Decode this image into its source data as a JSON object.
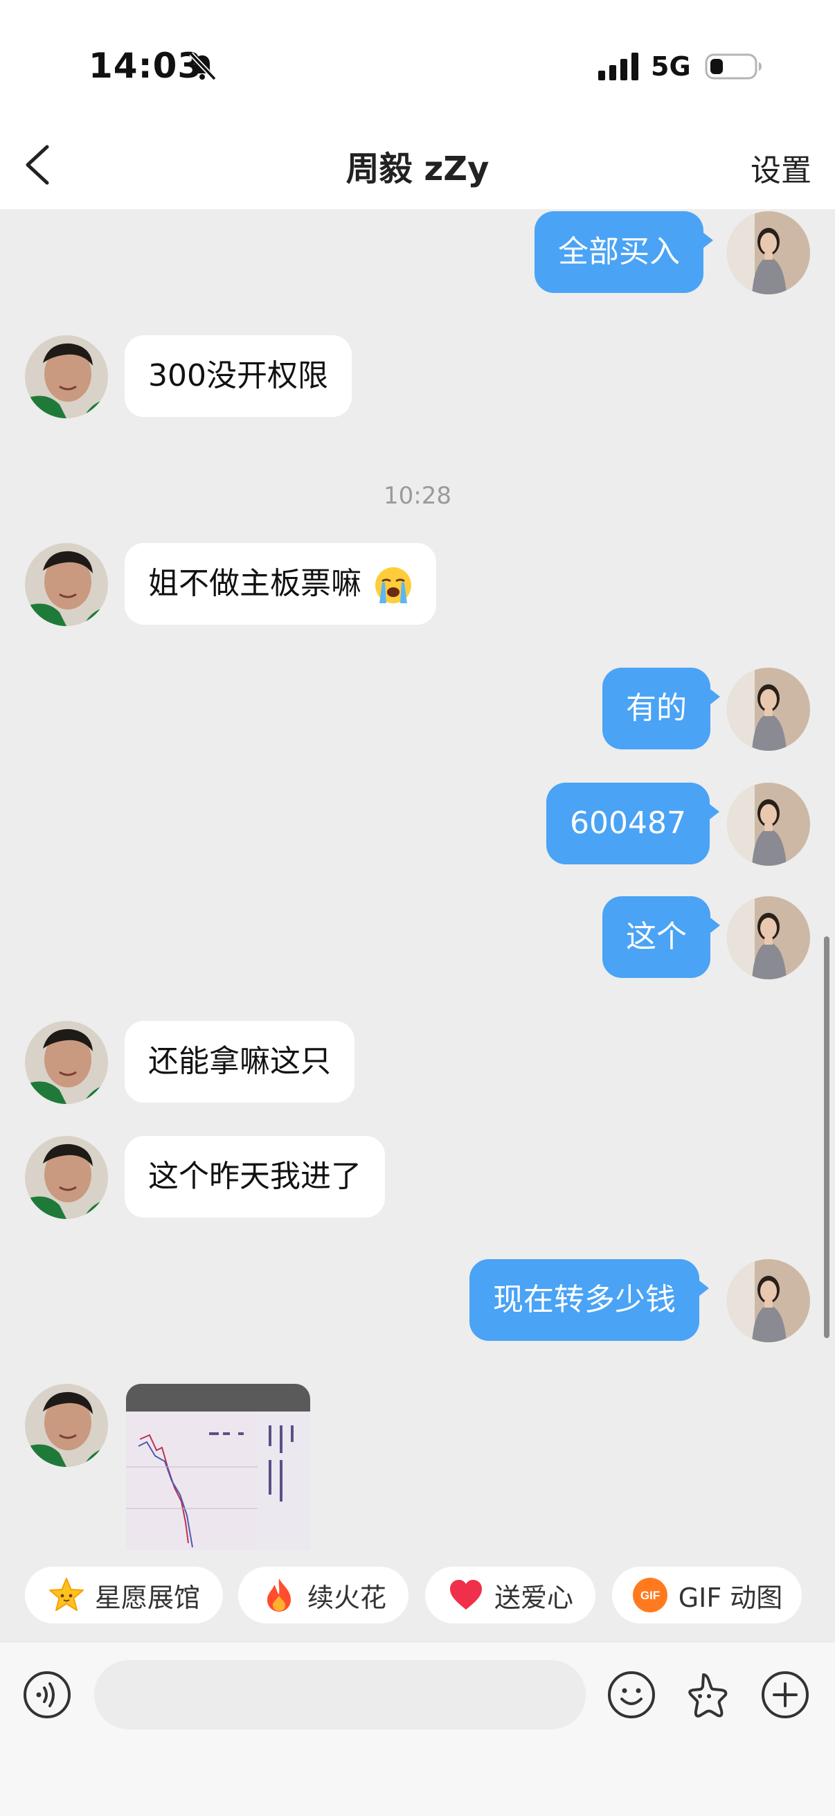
{
  "status_bar": {
    "time": "14:03",
    "network": "5G",
    "icons": [
      "bell-slash-icon",
      "signal-icon",
      "battery-icon"
    ]
  },
  "nav": {
    "title": "周毅 zZy",
    "settings": "设置",
    "back_icon": "chevron-left-icon"
  },
  "messages": [
    {
      "from": "me",
      "text": "全部买入"
    },
    {
      "from": "them",
      "text": "300没开权限"
    },
    {
      "type": "timestamp",
      "text": "10:28"
    },
    {
      "from": "them",
      "text": "姐不做主板票嘛",
      "emoji": "loudly-crying-face"
    },
    {
      "from": "me",
      "text": "有的"
    },
    {
      "from": "me",
      "text": "600487"
    },
    {
      "from": "me",
      "text": "这个"
    },
    {
      "from": "them",
      "text": "还能拿嘛这只"
    },
    {
      "from": "them",
      "text": "这个昨天我进了"
    },
    {
      "from": "me",
      "text": "现在转多少钱"
    },
    {
      "from": "them",
      "type": "image",
      "description_icon": "stock-chart-photo"
    }
  ],
  "quick_actions": [
    {
      "label": "星愿展馆",
      "icon": "star-icon"
    },
    {
      "label": "续火花",
      "icon": "fire-icon"
    },
    {
      "label": "送爱心",
      "icon": "heart-icon"
    },
    {
      "label": "GIF 动图",
      "icon": "gif-icon",
      "icon_text": "GIF"
    }
  ],
  "input_bar": {
    "placeholder": "",
    "icons": [
      "voice-icon",
      "emoji-icon",
      "sticker-icon",
      "plus-icon"
    ]
  },
  "colors": {
    "outgoing_bubble": "#4aa3f5",
    "incoming_bubble": "#ffffff",
    "background": "#ededed"
  }
}
